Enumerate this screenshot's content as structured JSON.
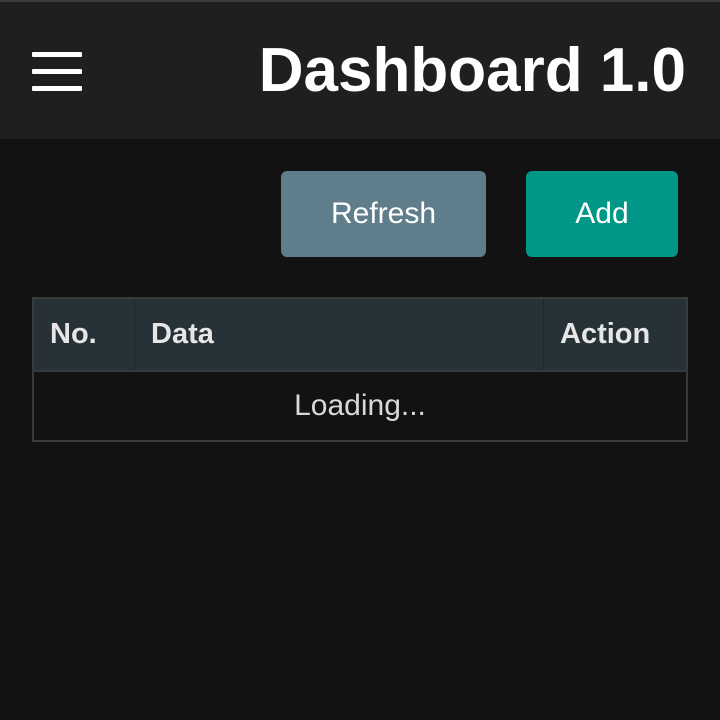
{
  "header": {
    "title": "Dashboard 1.0",
    "menu_icon": "hamburger-menu-icon"
  },
  "toolbar": {
    "refresh_label": "Refresh",
    "add_label": "Add"
  },
  "table": {
    "columns": [
      "No.",
      "Data",
      "Action"
    ],
    "loading_text": "Loading..."
  },
  "colors": {
    "background": "#121212",
    "header_bg": "#1f1f1f",
    "refresh_button": "#607d8b",
    "add_button": "#009688",
    "table_header_bg": "#263238"
  }
}
